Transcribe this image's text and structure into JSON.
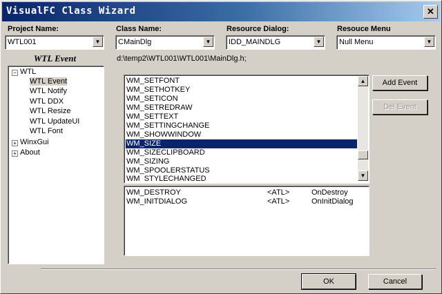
{
  "window": {
    "title": "VisualFC Class Wizard",
    "close_glyph": "✕"
  },
  "fields": {
    "project_name": {
      "label": "Project Name:",
      "value": "WTL001"
    },
    "class_name": {
      "label": "Class Name:",
      "value": "CMainDlg"
    },
    "resource_dialog": {
      "label": "Resource Dialog:",
      "value": "IDD_MAINDLG"
    },
    "resource_menu": {
      "label": "Resouce Menu",
      "value": "Null Menu"
    }
  },
  "left_panel": {
    "header": "WTL Event",
    "tree": {
      "root": {
        "label": "WTL",
        "expander": "−"
      },
      "children": [
        "WTL Event",
        "WTL Notify",
        "WTL DDX",
        "WTL Resize",
        "WTL UpdateUI",
        "WTL Font"
      ],
      "selected_child": "WTL Event",
      "others": [
        {
          "label": "WinxGui",
          "expander": "+"
        },
        {
          "label": "About",
          "expander": "+"
        }
      ]
    }
  },
  "file_path": "d:\\temp2\\WTL001\\WTL001\\MainDlg.h;",
  "events": {
    "items": [
      "WM_SETFONT",
      "WM_SETHOTKEY",
      "WM_SETICON",
      "WM_SETREDRAW",
      "WM_SETTEXT",
      "WM_SETTINGCHANGE",
      "WM_SHOWWINDOW",
      "WM_SIZE",
      "WM_SIZECLIPBOARD",
      "WM_SIZING",
      "WM_SPOOLERSTATUS",
      "WM_STYLECHANGED"
    ],
    "selected": "WM_SIZE"
  },
  "mapped_events": [
    {
      "message": "WM_DESTROY",
      "type": "<ATL>",
      "handler": "OnDestroy"
    },
    {
      "message": "WM_INITDIALOG",
      "type": "<ATL>",
      "handler": "OnInitDialog"
    }
  ],
  "buttons": {
    "add_event": "Add Event",
    "del_event": "Del Event",
    "ok": "OK",
    "cancel": "Cancel"
  },
  "icons": {
    "combo_arrow": "▼",
    "scroll_up": "▲",
    "scroll_down": "▼"
  },
  "colors": {
    "title_start": "#0a246a",
    "title_end": "#a6caf0",
    "selection": "#0a246a"
  }
}
